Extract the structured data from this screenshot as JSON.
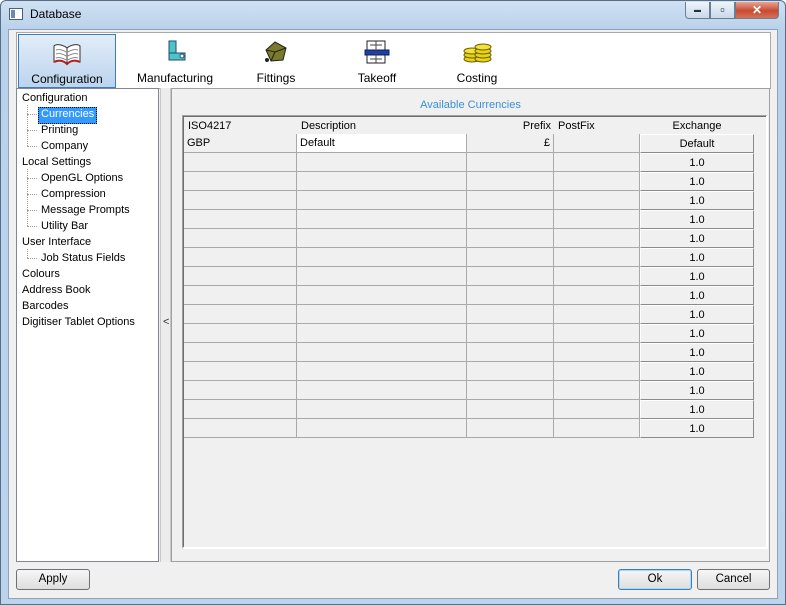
{
  "window": {
    "title": "Database",
    "icon": "database-window-icon"
  },
  "caption_buttons": {
    "minimize": "▬",
    "maximize": "▫",
    "close": "✕"
  },
  "ribbon": {
    "tabs": [
      {
        "label": "Configuration",
        "icon": "configuration-book-icon",
        "active": true
      },
      {
        "label": "Manufacturing",
        "icon": "manufacturing-duct-icon",
        "active": false
      },
      {
        "label": "Fittings",
        "icon": "fittings-icon",
        "active": false
      },
      {
        "label": "Takeoff",
        "icon": "takeoff-drawing-icon",
        "active": false
      },
      {
        "label": "Costing",
        "icon": "costing-coins-icon",
        "active": false
      }
    ]
  },
  "tree": {
    "items": [
      {
        "label": "Configuration",
        "level": 0
      },
      {
        "label": "Currencies",
        "level": 1,
        "selected": true
      },
      {
        "label": "Printing",
        "level": 1
      },
      {
        "label": "Company",
        "level": 1
      },
      {
        "label": "Local Settings",
        "level": 0
      },
      {
        "label": "OpenGL Options",
        "level": 1
      },
      {
        "label": "Compression",
        "level": 1
      },
      {
        "label": "Message Prompts",
        "level": 1
      },
      {
        "label": "Utility Bar",
        "level": 1
      },
      {
        "label": "User Interface",
        "level": 0
      },
      {
        "label": "Job Status Fields",
        "level": 1
      },
      {
        "label": "Colours",
        "level": 0
      },
      {
        "label": "Address Book",
        "level": 0
      },
      {
        "label": "Barcodes",
        "level": 0
      },
      {
        "label": "Digitiser Tablet Options",
        "level": 0
      }
    ]
  },
  "splitter": {
    "arrow": "<"
  },
  "currencies": {
    "title": "Available Currencies",
    "columns": [
      "ISO4217",
      "Description",
      "Prefix",
      "PostFix",
      "Exchange"
    ],
    "rows": [
      [
        "GBP",
        "Default",
        "£",
        "",
        "Default"
      ],
      [
        "",
        "",
        "",
        "",
        "1.0"
      ],
      [
        "",
        "",
        "",
        "",
        "1.0"
      ],
      [
        "",
        "",
        "",
        "",
        "1.0"
      ],
      [
        "",
        "",
        "",
        "",
        "1.0"
      ],
      [
        "",
        "",
        "",
        "",
        "1.0"
      ],
      [
        "",
        "",
        "",
        "",
        "1.0"
      ],
      [
        "",
        "",
        "",
        "",
        "1.0"
      ],
      [
        "",
        "",
        "",
        "",
        "1.0"
      ],
      [
        "",
        "",
        "",
        "",
        "1.0"
      ],
      [
        "",
        "",
        "",
        "",
        "1.0"
      ],
      [
        "",
        "",
        "",
        "",
        "1.0"
      ],
      [
        "",
        "",
        "",
        "",
        "1.0"
      ],
      [
        "",
        "",
        "",
        "",
        "1.0"
      ],
      [
        "",
        "",
        "",
        "",
        "1.0"
      ],
      [
        "",
        "",
        "",
        "",
        "1.0"
      ]
    ]
  },
  "buttons": {
    "apply": "Apply",
    "ok": "Ok",
    "cancel": "Cancel"
  }
}
